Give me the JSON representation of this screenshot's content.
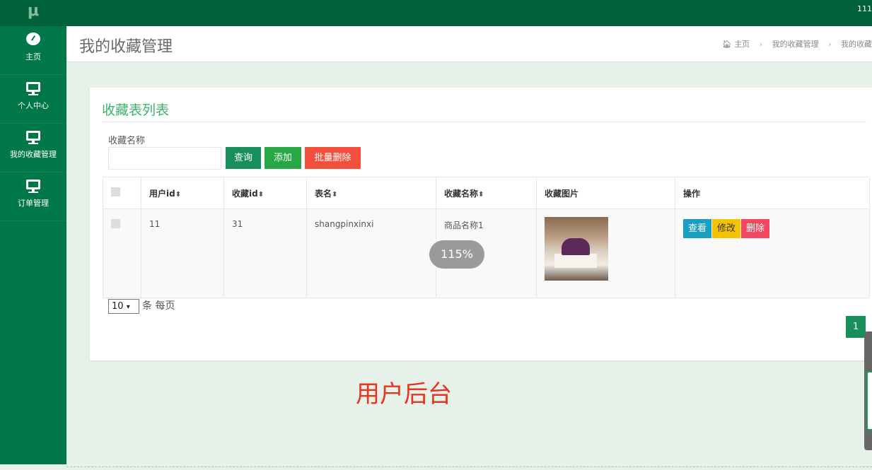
{
  "topbar": {
    "logo": "μ",
    "user": "111"
  },
  "sidebar": {
    "items": [
      {
        "label": "主页",
        "icon": "dashboard-icon"
      },
      {
        "label": "个人中心",
        "icon": "monitor-icon"
      },
      {
        "label": "我的收藏管理",
        "icon": "monitor-icon"
      },
      {
        "label": "订单管理",
        "icon": "monitor-icon"
      }
    ]
  },
  "header": {
    "title": "我的收藏管理",
    "breadcrumb": [
      "主页",
      "我的收藏管理",
      "我的收藏"
    ]
  },
  "card": {
    "title": "收藏表列表",
    "search_label": "收藏名称",
    "search_value": "",
    "buttons": {
      "query": "查询",
      "add": "添加",
      "batch_delete": "批量删除"
    },
    "table": {
      "headers": [
        "用户id",
        "收藏id",
        "表名",
        "收藏名称",
        "收藏图片",
        "操作"
      ],
      "rows": [
        {
          "user_id": "11",
          "fav_id": "31",
          "table_name": "shangpinxinxi",
          "fav_name": "商品名称1"
        }
      ],
      "actions": {
        "view": "查看",
        "edit": "修改",
        "delete": "删除"
      }
    },
    "page_size": "10",
    "page_size_suffix": "条 每页",
    "current_page": "1"
  },
  "zoom_overlay": "115%",
  "caption": "用户后台",
  "colors": {
    "topbar": "#00613a",
    "sidebar": "#00774a",
    "accent": "#3db36e",
    "danger": "#f2503c"
  }
}
